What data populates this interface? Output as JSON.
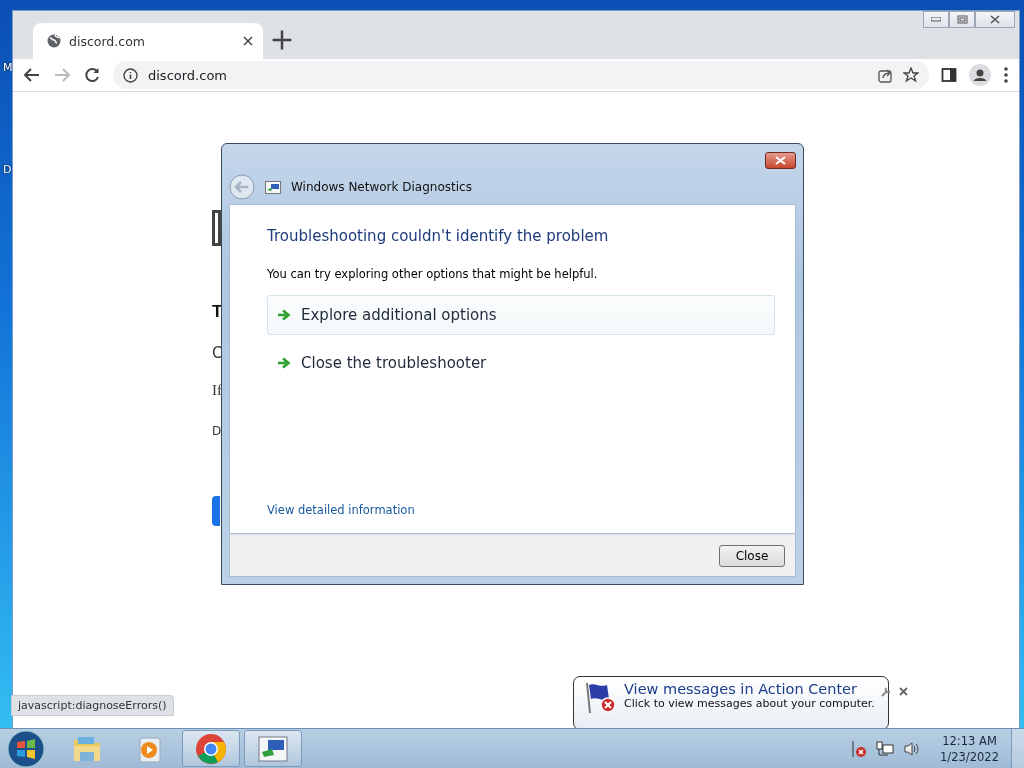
{
  "desktop": {
    "icon_labels": [
      "M",
      "D"
    ]
  },
  "browser": {
    "tabs": [
      {
        "label": "discord.com",
        "selected": true
      }
    ],
    "address": "discord.com",
    "page_fragments": [
      "T",
      "C",
      "If",
      "D"
    ],
    "status_url": "javascript:diagnoseErrors()"
  },
  "dialog": {
    "title": "Windows Network Diagnostics",
    "heading": "Troubleshooting couldn't identify the problem",
    "message": "You can try exploring other options that might be helpful.",
    "options": [
      {
        "label": "Explore additional options",
        "selected": true
      },
      {
        "label": "Close the troubleshooter",
        "selected": false
      }
    ],
    "link": "View detailed information",
    "button": "Close"
  },
  "notification": {
    "title": "View messages in Action Center",
    "message": "Click to view messages about your computer."
  },
  "taskbar": {
    "apps": [
      {
        "kind": "explorer",
        "running": false
      },
      {
        "kind": "media",
        "running": false
      },
      {
        "kind": "chrome",
        "running": true
      },
      {
        "kind": "network",
        "running": true
      }
    ],
    "clock": {
      "time": "12:13 AM",
      "date": "1/23/2022"
    }
  }
}
